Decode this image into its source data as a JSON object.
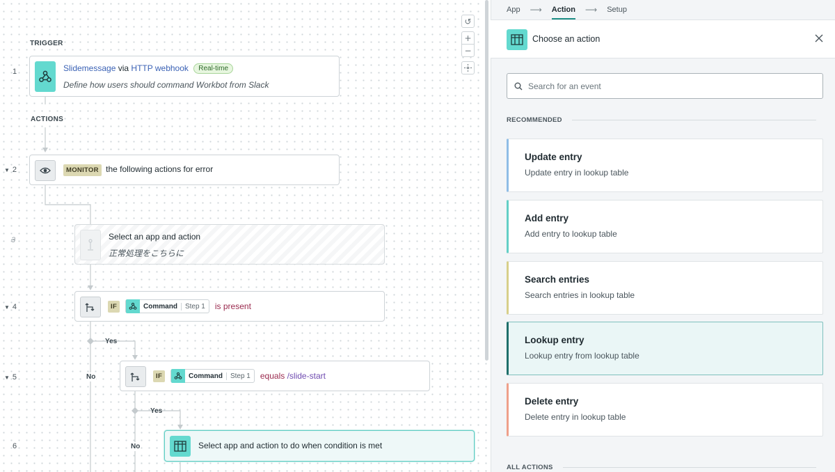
{
  "canvas": {
    "trigger_label": "TRIGGER",
    "actions_label": "ACTIONS",
    "steps": [
      {
        "num": "1",
        "app": "Slidemessage",
        "via": "via",
        "source": "HTTP webhook",
        "badge": "Real-time",
        "description": "Define how users should command Workbot from Slack",
        "icon": "webhook-icon"
      },
      {
        "num": "2",
        "keyword": "MONITOR",
        "text": "the following actions for error",
        "icon": "eye-icon"
      },
      {
        "num": "3",
        "title": "Select an app and action",
        "subtitle": "正常処理をこちらに",
        "icon": "placeholder-icon"
      },
      {
        "num": "4",
        "keyword": "IF",
        "pill_name": "Command",
        "pill_step": "Step 1",
        "condition": "is present",
        "icon": "branch-icon"
      },
      {
        "num": "5",
        "keyword": "IF",
        "pill_name": "Command",
        "pill_step": "Step 1",
        "operator": "equals",
        "value": "/slide-start",
        "icon": "branch-icon"
      },
      {
        "num": "6",
        "text": "Select app and action to do when condition is met",
        "icon": "table-icon"
      }
    ],
    "branches": {
      "yes": "Yes",
      "no": "No"
    },
    "controls": [
      "undo-icon",
      "zoom-in-icon",
      "zoom-out-icon",
      "fit-icon"
    ]
  },
  "panel": {
    "wizard": [
      {
        "label": "App",
        "active": false
      },
      {
        "label": "Action",
        "active": true
      },
      {
        "label": "Setup",
        "active": false
      }
    ],
    "arrow_glyph": "⟶",
    "header_title": "Choose an action",
    "header_icon": "table-icon",
    "search_placeholder": "Search for an event",
    "recommended_label": "RECOMMENDED",
    "all_actions_label": "ALL ACTIONS",
    "actions": [
      {
        "title": "Update entry",
        "description": "Update entry in lookup table",
        "accent": "#8fbde6",
        "selected": false
      },
      {
        "title": "Add entry",
        "description": "Add entry to lookup table",
        "accent": "#63cfc6",
        "selected": false
      },
      {
        "title": "Search entries",
        "description": "Search entries in lookup table",
        "accent": "#d7cf8a",
        "selected": false
      },
      {
        "title": "Lookup entry",
        "description": "Lookup entry from lookup table",
        "accent": "#1f6f6a",
        "selected": true
      },
      {
        "title": "Delete entry",
        "description": "Delete entry in lookup table",
        "accent": "#ef9f8a",
        "selected": false
      }
    ]
  },
  "colors": {
    "teal": "#63d9cf",
    "accent_dark": "#1f8f86",
    "monitor_badge": "#dcd8b2",
    "condition": "#9a2a4e",
    "value": "#6f4bb0"
  }
}
